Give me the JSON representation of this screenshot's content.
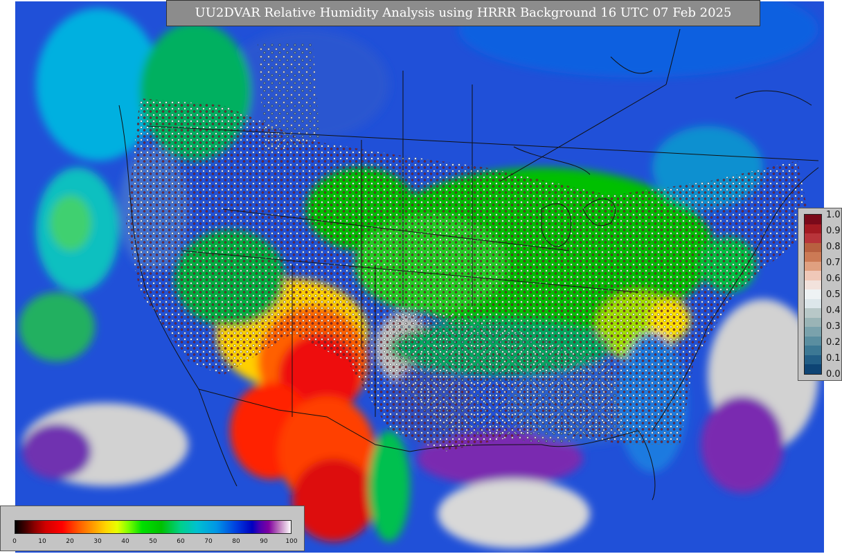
{
  "title": "UU2DVAR Relative Humidity Analysis using HRRR Background 16 UTC 07 Feb 2025",
  "ob_colorbar": {
    "labels": [
      "1.0",
      "0.9",
      "0.8",
      "0.7",
      "0.6",
      "0.5",
      "0.4",
      "0.3",
      "0.2",
      "0.1",
      "0.0"
    ],
    "colors": [
      "#7a0a1a",
      "#a31a22",
      "#b8343a",
      "#b86040",
      "#cc7a55",
      "#e0a080",
      "#f0c8b8",
      "#f2e2dc",
      "#eef2f4",
      "#dce6ea",
      "#b8c8c8",
      "#9ab4b6",
      "#7aa2ac",
      "#5a8ea0",
      "#3c7894",
      "#225e86",
      "#0e4474"
    ]
  },
  "rh_colorbar": {
    "ticks": [
      "0",
      "10",
      "20",
      "30",
      "40",
      "50",
      "60",
      "70",
      "80",
      "90",
      "100"
    ]
  },
  "colors": {
    "background_blue": "#2050d8",
    "panel_gray": "#c4c4c4",
    "title_gray": "#8c8c8c"
  }
}
